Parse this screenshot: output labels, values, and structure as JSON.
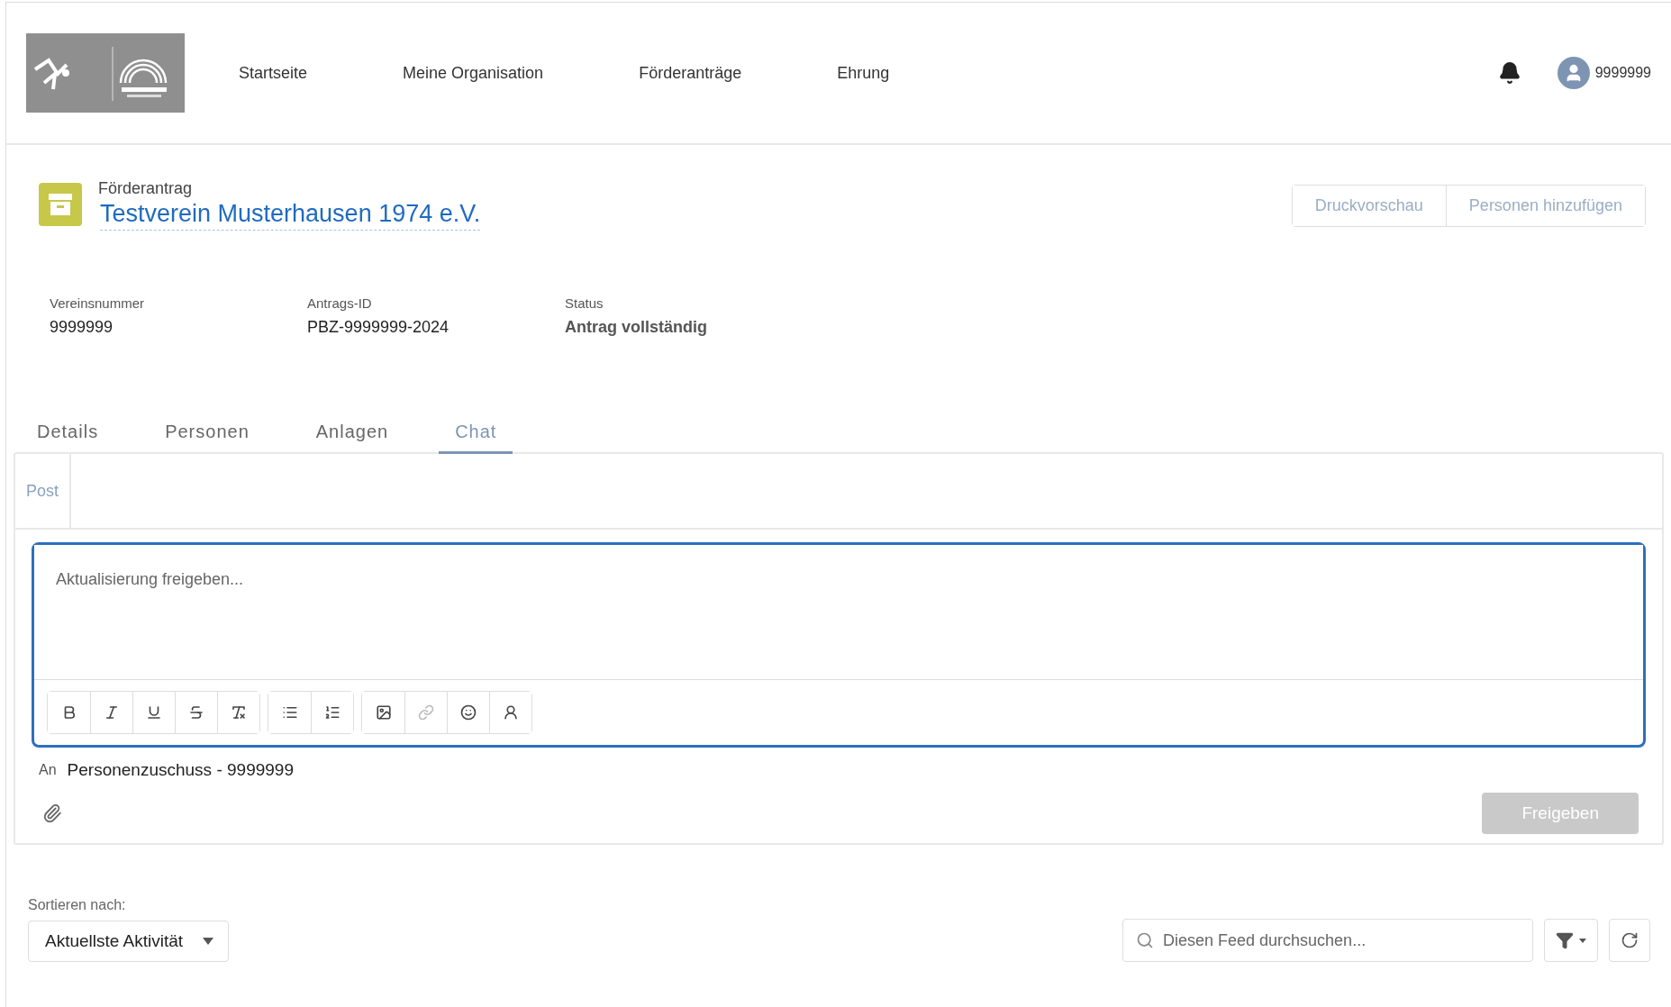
{
  "nav": {
    "items": [
      {
        "label": "Startseite"
      },
      {
        "label": "Meine Organisation"
      },
      {
        "label": "Förderanträge"
      },
      {
        "label": "Ehrung"
      }
    ],
    "user": "9999999"
  },
  "record": {
    "type_label": "Förderantrag",
    "title": "Testverein Musterhausen 1974 e.V.",
    "actions": [
      {
        "label": "Druckvorschau"
      },
      {
        "label": "Personen hinzufügen"
      }
    ],
    "fields": [
      {
        "label": "Vereinsnummer",
        "value": "9999999",
        "emphasis": false
      },
      {
        "label": "Antrags-ID",
        "value": "PBZ-9999999-2024",
        "emphasis": false
      },
      {
        "label": "Status",
        "value": "Antrag vollständig",
        "emphasis": true
      }
    ]
  },
  "tabs": [
    {
      "label": "Details",
      "selected": false
    },
    {
      "label": "Personen",
      "selected": false
    },
    {
      "label": "Anlagen",
      "selected": false
    },
    {
      "label": "Chat",
      "selected": true
    }
  ],
  "publisher": {
    "tab": "Post",
    "placeholder": "Aktualisierung freigeben...",
    "toolbar_groups": [
      {
        "buttons": [
          {
            "kind": "bold"
          },
          {
            "kind": "italic"
          },
          {
            "kind": "underline"
          },
          {
            "kind": "strike"
          },
          {
            "kind": "clear"
          }
        ]
      },
      {
        "buttons": [
          {
            "kind": "bullets"
          },
          {
            "kind": "numbers"
          }
        ]
      },
      {
        "buttons": [
          {
            "kind": "image"
          },
          {
            "kind": "link"
          },
          {
            "kind": "emoji"
          },
          {
            "kind": "mention"
          }
        ]
      }
    ],
    "to_label": "An",
    "to_value": "Personenzuschuss - 9999999",
    "submit": {
      "label": "Freigeben",
      "disabled": true
    }
  },
  "feed": {
    "sort_label": "Sortieren nach:",
    "sort_value": "Aktuellste Aktivität",
    "search_placeholder": "Diesen Feed durchsuchen..."
  }
}
